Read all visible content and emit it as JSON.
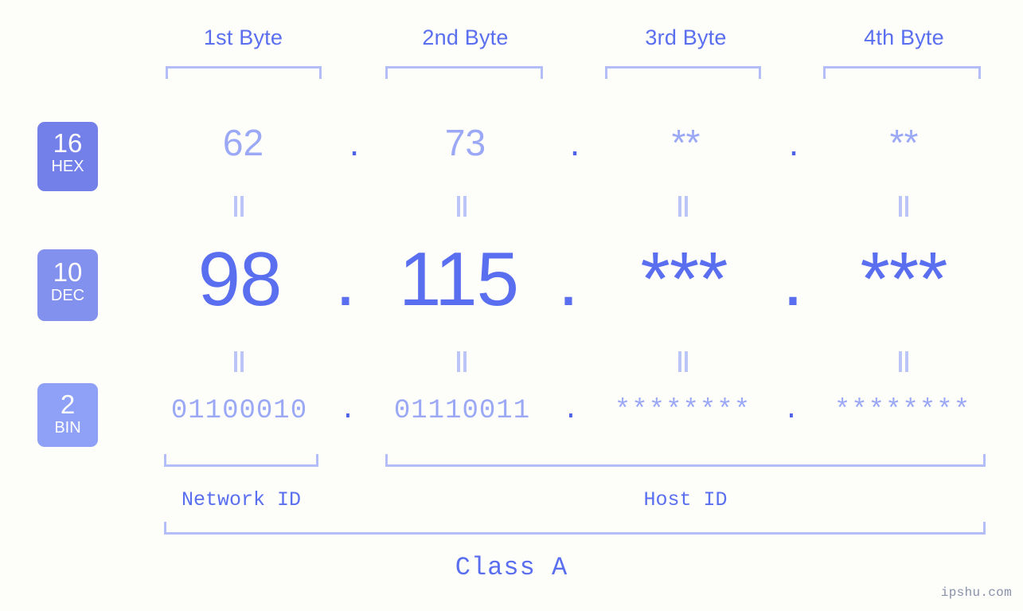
{
  "meta": {
    "background_color": "#fdfdfa",
    "accent_color": "#5a6ff0",
    "accent_light_color": "#9aa8f5",
    "bracket_color": "#b3bdf7",
    "watermark": "ipshu.com"
  },
  "byte_headers": [
    {
      "label": "1st Byte"
    },
    {
      "label": "2nd Byte"
    },
    {
      "label": "3rd Byte"
    },
    {
      "label": "4th Byte"
    }
  ],
  "rows": {
    "hex": {
      "badge_number": "16",
      "badge_name": "HEX",
      "values": [
        "62",
        "73",
        "**",
        "**"
      ],
      "separator": "."
    },
    "dec": {
      "badge_number": "10",
      "badge_name": "DEC",
      "values": [
        "98",
        "115",
        "***",
        "***"
      ],
      "separator": "."
    },
    "bin": {
      "badge_number": "2",
      "badge_name": "BIN",
      "values": [
        "01100010",
        "01110011",
        "********",
        "********"
      ],
      "separator": "."
    }
  },
  "id_sections": [
    {
      "label": "Network ID"
    },
    {
      "label": "Host ID"
    }
  ],
  "class_label": "Class A"
}
